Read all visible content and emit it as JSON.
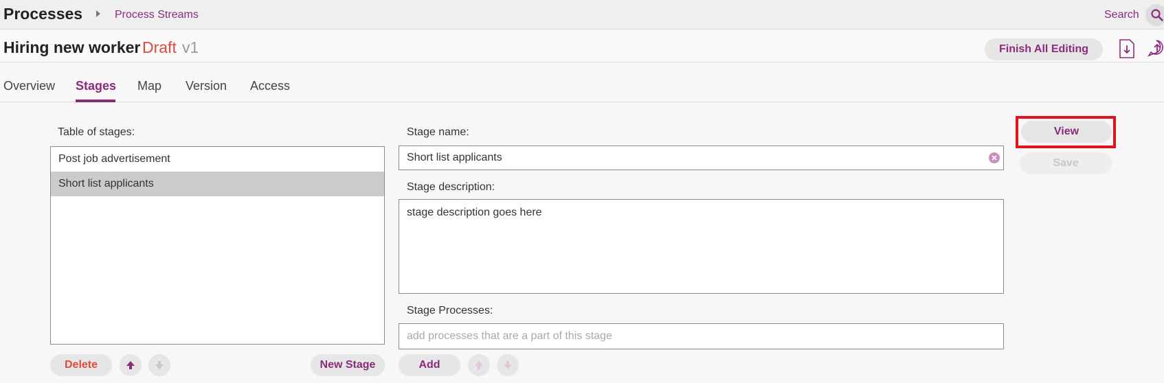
{
  "topbar": {
    "app_title": "Processes",
    "breadcrumb": "Process Streams",
    "search_label": "Search"
  },
  "process": {
    "name": "Hiring new worker",
    "status": "Draft",
    "version": "v1",
    "finish_label": "Finish All Editing"
  },
  "tabs": [
    {
      "label": "Overview"
    },
    {
      "label": "Stages",
      "active": true
    },
    {
      "label": "Map"
    },
    {
      "label": "Version"
    },
    {
      "label": "Access"
    }
  ],
  "stages_table": {
    "label": "Table of stages:",
    "items": [
      {
        "name": "Post job advertisement",
        "selected": false
      },
      {
        "name": "Short list applicants",
        "selected": true
      }
    ],
    "delete_label": "Delete",
    "new_stage_label": "New Stage"
  },
  "stage_form": {
    "name_label": "Stage name:",
    "name_value": "Short list applicants",
    "description_label": "Stage description:",
    "description_value": "stage description goes here",
    "processes_label": "Stage Processes:",
    "processes_placeholder": "add processes that are a part of this stage",
    "add_label": "Add"
  },
  "actions": {
    "view_label": "View",
    "save_label": "Save"
  },
  "colors": {
    "accent": "#8c2a7c",
    "draft": "#e04a3a",
    "highlight": "#e0141e"
  }
}
